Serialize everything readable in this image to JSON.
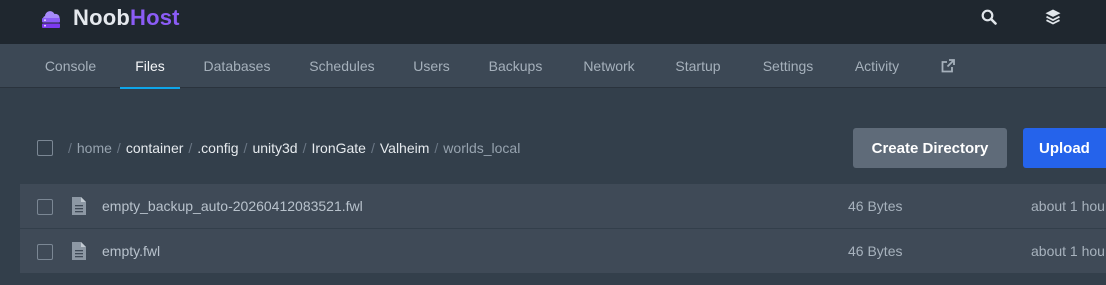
{
  "brand": {
    "name_first": "Noob",
    "name_second": "Host",
    "logo_icon": "server-cloud-icon",
    "accent_color": "#8b5cf6"
  },
  "topbar": {
    "icons": [
      "search-icon",
      "layers-icon"
    ]
  },
  "tabs": [
    {
      "label": "Console"
    },
    {
      "label": "Files",
      "active": true
    },
    {
      "label": "Databases"
    },
    {
      "label": "Schedules"
    },
    {
      "label": "Users"
    },
    {
      "label": "Backups"
    },
    {
      "label": "Network"
    },
    {
      "label": "Startup"
    },
    {
      "label": "Settings"
    },
    {
      "label": "Activity"
    }
  ],
  "external_link_icon": "external-link-icon",
  "breadcrumb": {
    "separator": "/",
    "segments": [
      "home",
      "container",
      ".config",
      "unity3d",
      "IronGate",
      "Valheim",
      "worlds_local"
    ]
  },
  "actions": {
    "create_directory": "Create Directory",
    "upload": "Upload",
    "upload_color": "#2563eb"
  },
  "files": [
    {
      "name": "empty_backup_auto-20260412083521.fwl",
      "size": "46 Bytes",
      "modified": "about 1 hou",
      "icon": "file-icon"
    },
    {
      "name": "empty.fwl",
      "size": "46 Bytes",
      "modified": "about 1 hou",
      "icon": "file-icon"
    }
  ]
}
